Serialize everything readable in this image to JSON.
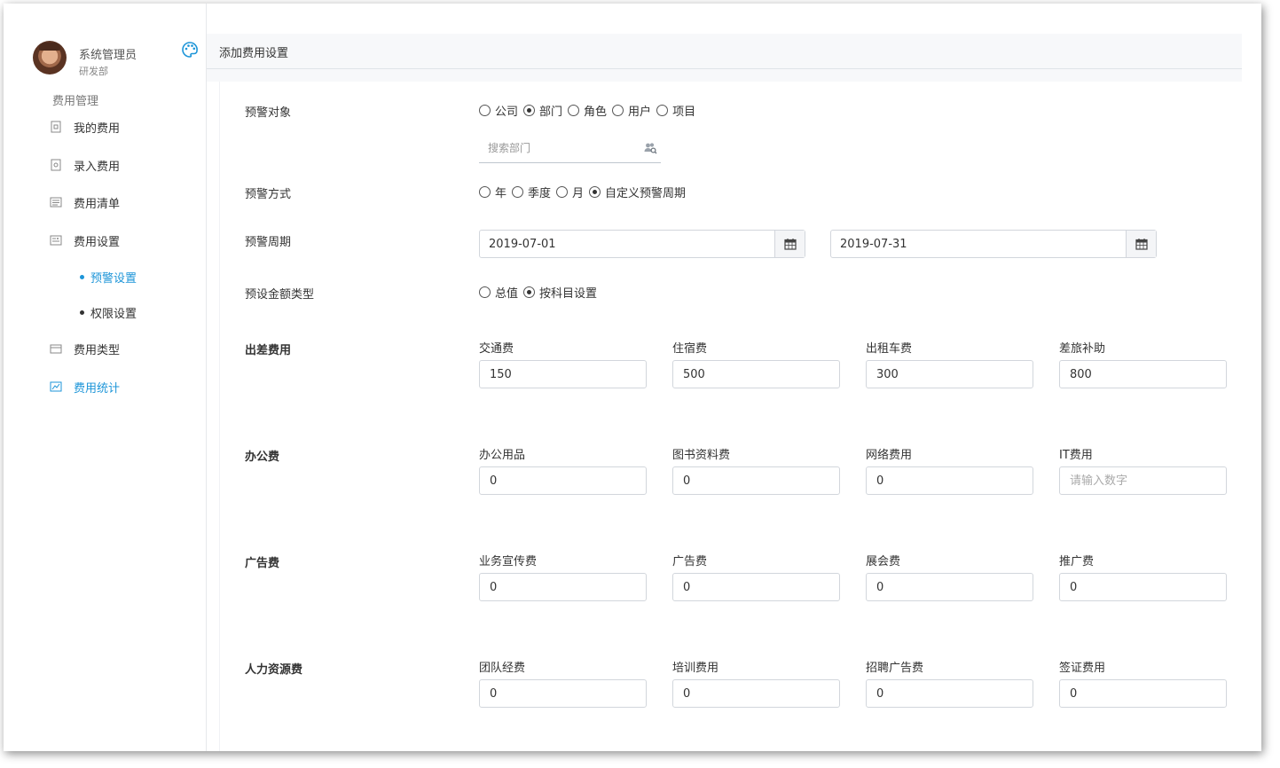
{
  "user": {
    "name": "系统管理员",
    "dept": "研发部"
  },
  "nav": {
    "section_title": "费用管理",
    "items": [
      {
        "label": "我的费用",
        "icon": "document-icon"
      },
      {
        "label": "录入费用",
        "icon": "document-edit-icon"
      },
      {
        "label": "费用清单",
        "icon": "list-icon"
      },
      {
        "label": "费用设置",
        "icon": "settings-sheet-icon"
      },
      {
        "label": "费用类型",
        "icon": "card-icon"
      },
      {
        "label": "费用统计",
        "icon": "chart-icon"
      }
    ],
    "sub_items": [
      {
        "label": "预警设置"
      },
      {
        "label": "权限设置"
      }
    ]
  },
  "page": {
    "title": "添加费用设置"
  },
  "form": {
    "target": {
      "label": "预警对象",
      "options": [
        "公司",
        "部门",
        "角色",
        "用户",
        "项目"
      ],
      "selected": "部门",
      "search_placeholder": "搜索部门"
    },
    "method": {
      "label": "预警方式",
      "options": [
        "年",
        "季度",
        "月",
        "自定义预警周期"
      ],
      "selected": "自定义预警周期"
    },
    "period": {
      "label": "预警周期",
      "start": "2019-07-01",
      "end": "2019-07-31"
    },
    "amount_type": {
      "label": "预设金额类型",
      "options": [
        "总值",
        "按科目设置"
      ],
      "selected": "按科目设置"
    },
    "groups": [
      {
        "label": "出差费用",
        "fields": [
          {
            "label": "交通费",
            "value": "150",
            "placeholder": "请输入数字"
          },
          {
            "label": "住宿费",
            "value": "500",
            "placeholder": "请输入数字"
          },
          {
            "label": "出租车费",
            "value": "300",
            "placeholder": "请输入数字"
          },
          {
            "label": "差旅补助",
            "value": "800",
            "placeholder": "请输入数字"
          }
        ]
      },
      {
        "label": "办公费",
        "fields": [
          {
            "label": "办公用品",
            "value": "0",
            "placeholder": "请输入数字"
          },
          {
            "label": "图书资料费",
            "value": "0",
            "placeholder": "请输入数字"
          },
          {
            "label": "网络费用",
            "value": "0",
            "placeholder": "请输入数字"
          },
          {
            "label": "IT费用",
            "value": "",
            "placeholder": "请输入数字"
          }
        ]
      },
      {
        "label": "广告费",
        "fields": [
          {
            "label": "业务宣传费",
            "value": "0",
            "placeholder": "请输入数字"
          },
          {
            "label": "广告费",
            "value": "0",
            "placeholder": "请输入数字"
          },
          {
            "label": "展会费",
            "value": "0",
            "placeholder": "请输入数字"
          },
          {
            "label": "推广费",
            "value": "0",
            "placeholder": "请输入数字"
          }
        ]
      },
      {
        "label": "人力资源费",
        "fields": [
          {
            "label": "团队经费",
            "value": "0",
            "placeholder": "请输入数字"
          },
          {
            "label": "培训费用",
            "value": "0",
            "placeholder": "请输入数字"
          },
          {
            "label": "招聘广告费",
            "value": "0",
            "placeholder": "请输入数字"
          },
          {
            "label": "签证费用",
            "value": "0",
            "placeholder": "请输入数字"
          }
        ]
      }
    ]
  },
  "colors": {
    "accent": "#1d95d8",
    "border": "#d2d6dc",
    "topbar_bg": "#f7f8fa"
  }
}
